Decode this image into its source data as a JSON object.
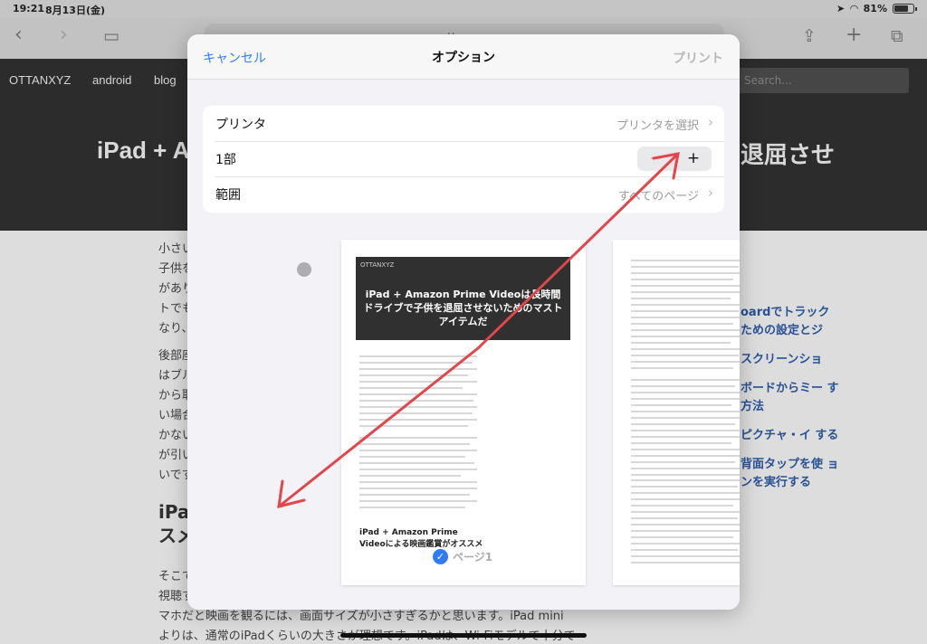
{
  "status_bar": {
    "time": "19:21",
    "date": "8月13日(金)",
    "battery": "81%",
    "battery_fraction": 0.81
  },
  "browser": {
    "url": "ottanxyz"
  },
  "site": {
    "nav": [
      "OTTANXYZ",
      "android",
      "blog"
    ],
    "search_placeholder": "Search...",
    "title_left": "iPad + A",
    "title_right": "退屈させ",
    "body_lines_top": [
      "小さい",
      "子供を",
      "があり",
      "トでも",
      "なり、"
    ],
    "body_lines_mid": [
      "後部座",
      "はブル",
      "から取",
      "い場合",
      "かない",
      "が引い",
      "いです"
    ],
    "heading_lines": [
      "iPad",
      "スメ"
    ],
    "bottom_lines": [
      "そこで",
      "視聴す",
      "マホだと映画を観るには、画面サイズが小さすぎるかと思います。iPad mini",
      "よりは、通常のiPadくらいの大きさが理想です。iPadは、Wi-Fiモデルで十分で"
    ],
    "toc": [
      "oardでトラック ための設定とジ",
      "スクリーンショ",
      "ボードからミー す方法",
      "ピクチャ・イ する",
      "背面タップを使 ョンを実行する"
    ]
  },
  "sheet": {
    "cancel": "キャンセル",
    "title": "オプション",
    "print": "プリント",
    "printer_label": "プリンタ",
    "printer_value": "プリンタを選択",
    "copies_label": "1部",
    "minus": "−",
    "plus": "+",
    "range_label": "範囲",
    "range_value": "すべてのページ"
  },
  "preview": {
    "brand": "OTTANXYZ",
    "title": "iPad + Amazon Prime Videoは長時間ドライブで子供を退屈させないためのマストアイテムだ",
    "subheading": "iPad + Amazon Prime Videoによる映画鑑賞がオススメ",
    "page_label": "ページ1"
  },
  "colors": {
    "accent": "#2f7cf6",
    "arrow": "#e0464a",
    "site_dark": "#303030"
  }
}
